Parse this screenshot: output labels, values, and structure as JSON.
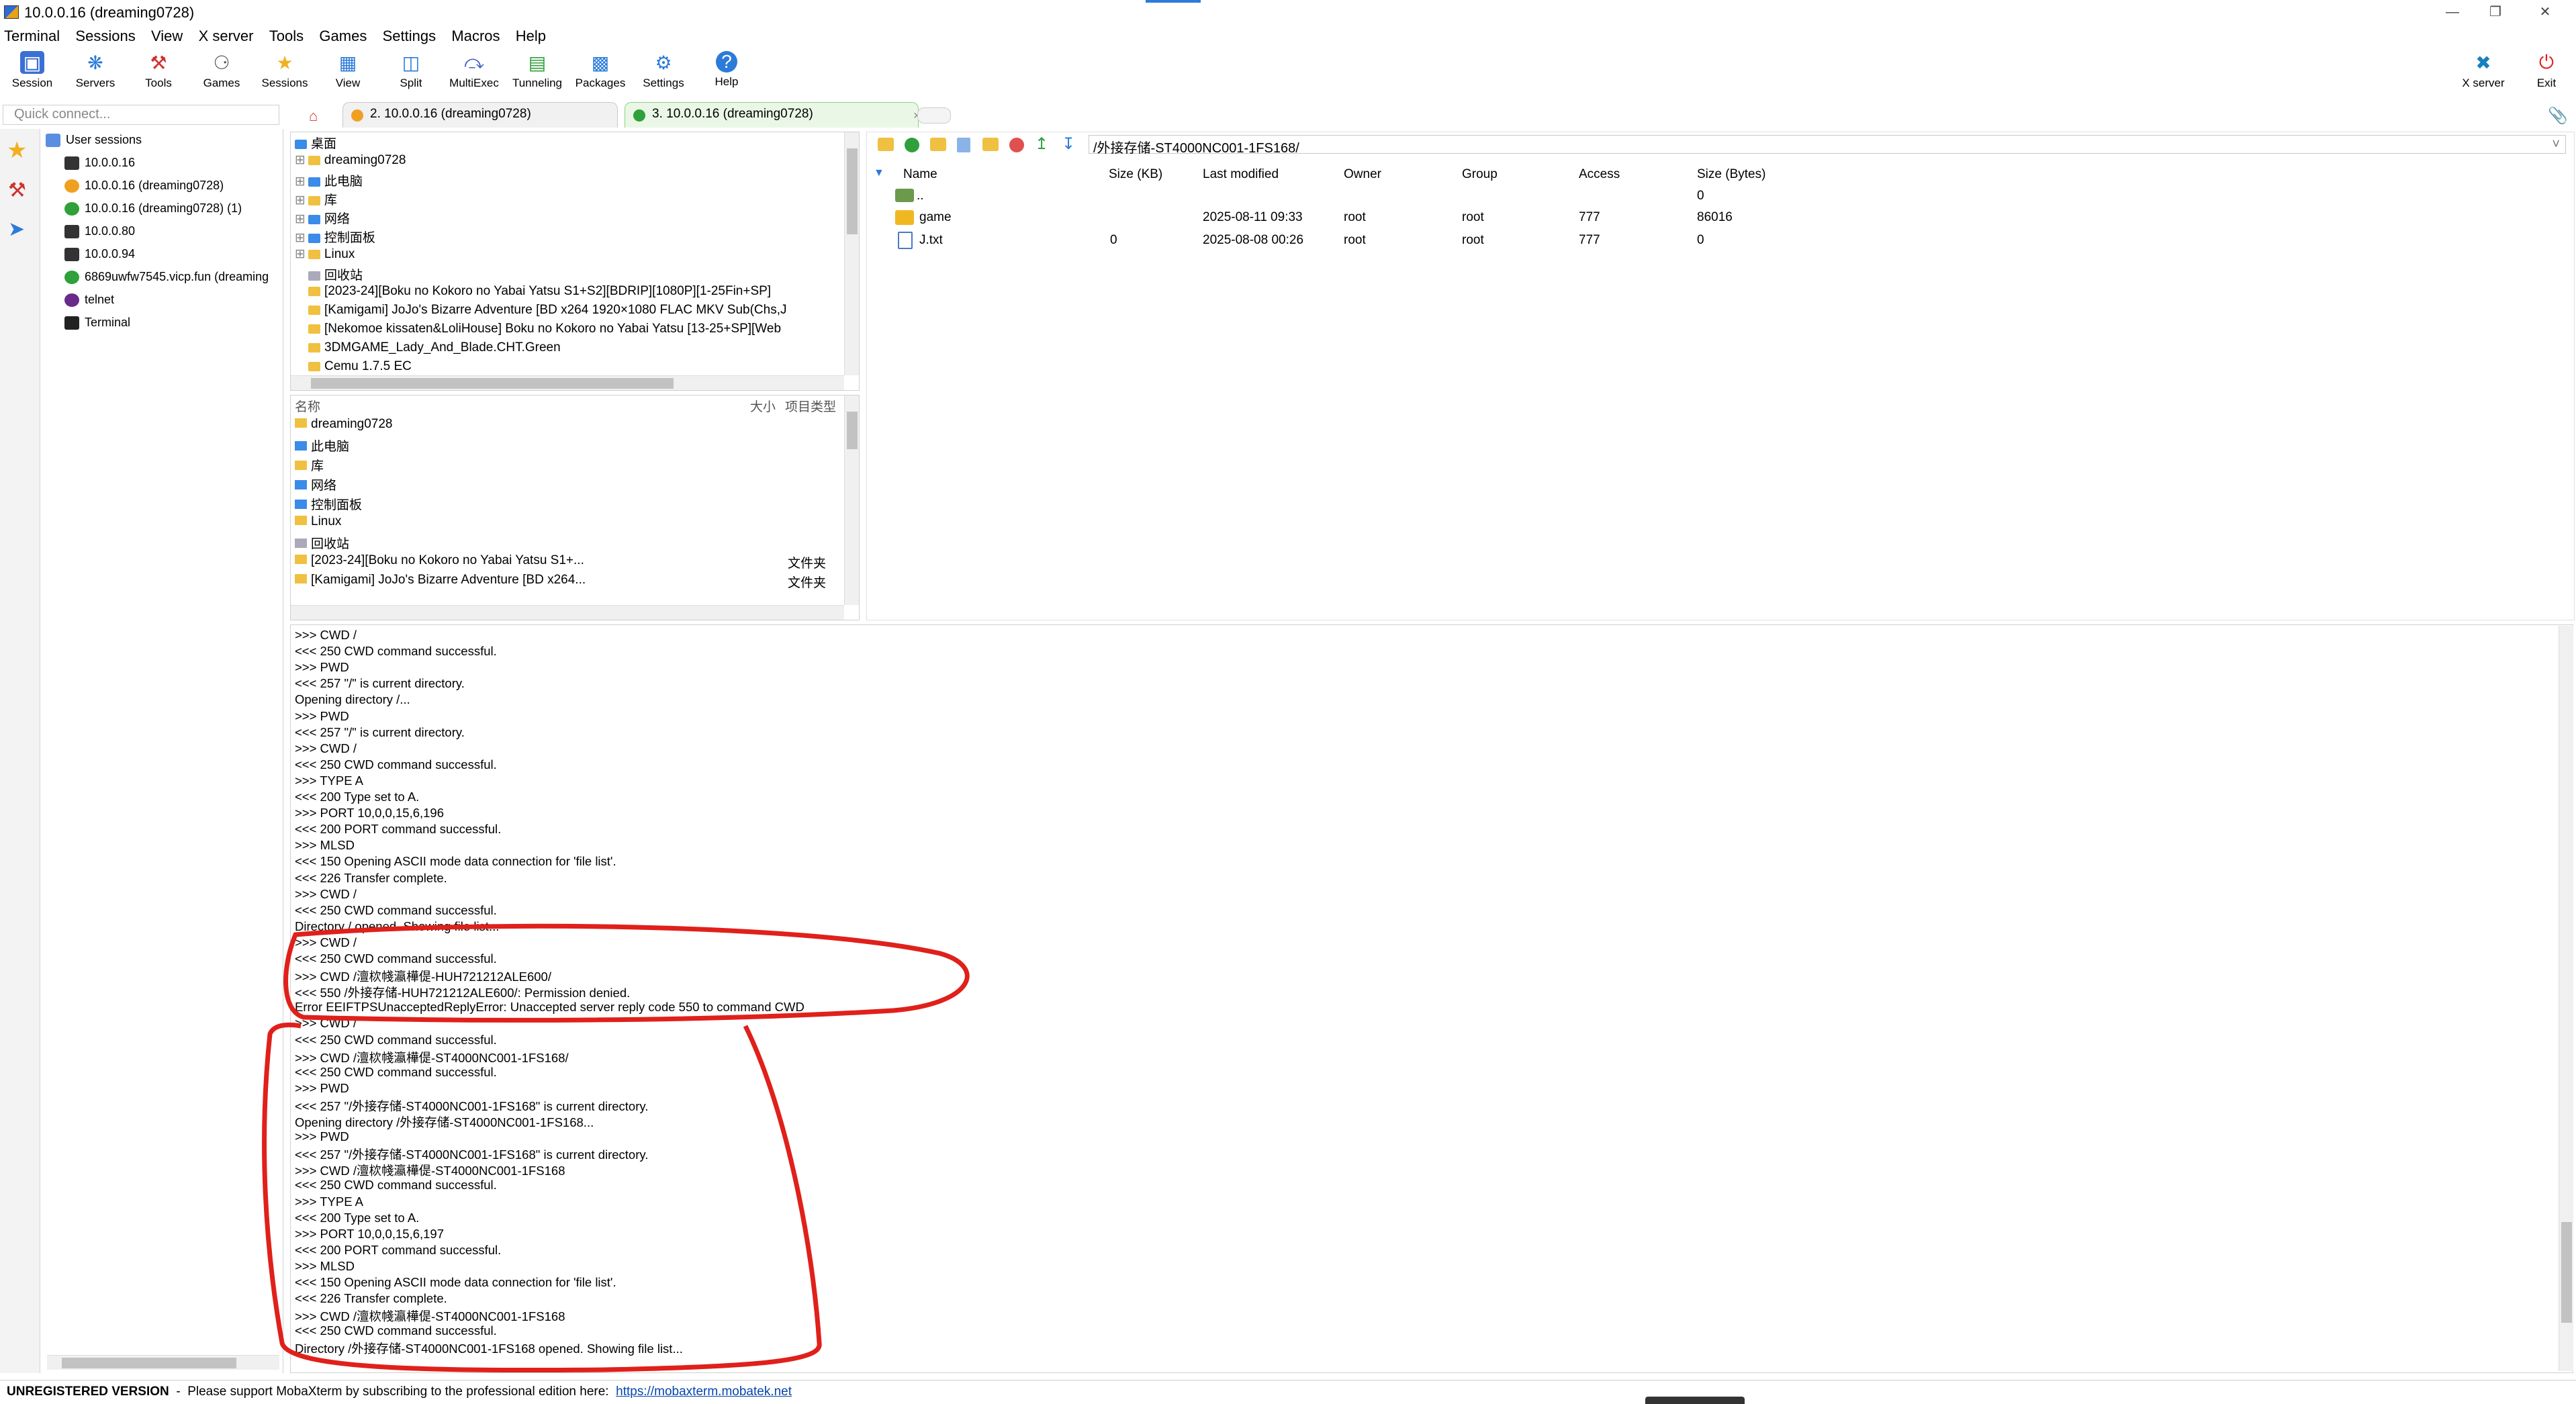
{
  "window": {
    "title": "10.0.0.16 (dreaming0728)"
  },
  "menu": [
    "Terminal",
    "Sessions",
    "View",
    "X server",
    "Tools",
    "Games",
    "Settings",
    "Macros",
    "Help"
  ],
  "toolbar": {
    "items": [
      "Session",
      "Servers",
      "Tools",
      "Games",
      "Sessions",
      "View",
      "Split",
      "MultiExec",
      "Tunneling",
      "Packages",
      "Settings",
      "Help"
    ],
    "right_items": [
      "X server",
      "Exit"
    ]
  },
  "quick_connect": {
    "placeholder": "Quick connect..."
  },
  "tabs": [
    {
      "label": "2. 10.0.0.16 (dreaming0728)",
      "active": false,
      "color": "#f0a020"
    },
    {
      "label": "3. 10.0.0.16 (dreaming0728)",
      "active": true,
      "color": "#2fa03a"
    }
  ],
  "sessions": {
    "header": "User sessions",
    "items": [
      {
        "label": "10.0.0.16",
        "color": "#333333"
      },
      {
        "label": "10.0.0.16 (dreaming0728)",
        "color": "#f0a020"
      },
      {
        "label": "10.0.0.16 (dreaming0728) (1)",
        "color": "#2fa03a"
      },
      {
        "label": "10.0.0.80",
        "color": "#333333"
      },
      {
        "label": "10.0.0.94",
        "color": "#333333"
      },
      {
        "label": "6869uwfw7545.vicp.fun (dreaming",
        "color": "#2fa03a"
      },
      {
        "label": "telnet",
        "color": "#6a2a8a"
      },
      {
        "label": "Terminal",
        "color": "#222222"
      }
    ]
  },
  "local_tree": {
    "items": [
      "桌面",
      "dreaming0728",
      "此电脑",
      "库",
      "网络",
      "控制面板",
      "Linux",
      "回收站",
      "[2023-24][Boku no Kokoro no Yabai Yatsu S1+S2][BDRIP][1080P][1-25Fin+SP]",
      "[Kamigami] JoJo's Bizarre Adventure [BD x264 1920×1080 FLAC MKV Sub(Chs,J",
      "[Nekomoe kissaten&LoliHouse] Boku no Kokoro no Yabai Yatsu [13-25+SP][Web",
      "3DMGAME_Lady_And_Blade.CHT.Green",
      "Cemu 1.7.5 EC"
    ]
  },
  "local_list": {
    "headers": {
      "name": "名称",
      "size": "大小",
      "type": "项目类型"
    },
    "rows": [
      {
        "name": "dreaming0728",
        "type": ""
      },
      {
        "name": "此电脑",
        "type": ""
      },
      {
        "name": "库",
        "type": ""
      },
      {
        "name": "网络",
        "type": ""
      },
      {
        "name": "控制面板",
        "type": ""
      },
      {
        "name": "Linux",
        "type": ""
      },
      {
        "name": "回收站",
        "type": ""
      },
      {
        "name": "[2023-24][Boku no Kokoro no Yabai Yatsu S1+...",
        "type": "文件夹"
      },
      {
        "name": "[Kamigami] JoJo's Bizarre Adventure [BD x264...",
        "type": "文件夹"
      }
    ]
  },
  "remote": {
    "path": "/外接存储-ST4000NC001-1FS168/",
    "headers": [
      "Name",
      "Size (KB)",
      "Last modified",
      "Owner",
      "Group",
      "Access",
      "Size (Bytes)"
    ],
    "rows": [
      {
        "name": "..",
        "size": "",
        "modified": "",
        "owner": "",
        "group": "",
        "access": "",
        "bytes": "0",
        "icon": "up-icon"
      },
      {
        "name": "game",
        "size": "",
        "modified": "2025-08-11 09:33",
        "owner": "root",
        "group": "root",
        "access": "777",
        "bytes": "86016",
        "icon": "folder-icon"
      },
      {
        "name": "J.txt",
        "size": "0",
        "modified": "2025-08-08 00:26",
        "owner": "root",
        "group": "root",
        "access": "777",
        "bytes": "0",
        "icon": "file-icon"
      }
    ]
  },
  "log": [
    ">>>  CWD /",
    "<<<  250 CWD command successful.",
    ">>>  PWD",
    "<<<  257 \"/\" is current directory.",
    "Opening directory /...",
    ">>>  PWD",
    "<<<  257 \"/\" is current directory.",
    ">>>  CWD /",
    "<<<  250 CWD command successful.",
    ">>>  TYPE A",
    "<<<  200 Type set to A.",
    ">>>  PORT 10,0,0,15,6,196",
    "<<<  200 PORT command successful.",
    ">>>  MLSD",
    "<<<  150 Opening ASCII mode data connection for 'file list'.",
    "<<<  226 Transfer complete.",
    ">>>  CWD /",
    "<<<  250 CWD command successful.",
    "Directory / opened. Showing file list...",
    ">>>  CWD /",
    "<<<  250 CWD command successful.",
    ">>>  CWD /澶栨帴瀛樺偍-HUH721212ALE600/",
    "<<<  550 /外接存储-HUH721212ALE600/: Permission denied.",
    "Error EEIFTPSUnacceptedReplyError: Unaccepted server reply code 550 to command CWD",
    ">>>  CWD /",
    "<<<  250 CWD command successful.",
    ">>>  CWD /澶栨帴瀛樺偍-ST4000NC001-1FS168/",
    "<<<  250 CWD command successful.",
    ">>>  PWD",
    "<<<  257 \"/外接存储-ST4000NC001-1FS168\" is current directory.",
    "Opening directory /外接存储-ST4000NC001-1FS168...",
    ">>>  PWD",
    "<<<  257 \"/外接存储-ST4000NC001-1FS168\" is current directory.",
    ">>>  CWD /澶栨帴瀛樺偍-ST4000NC001-1FS168",
    "<<<  250 CWD command successful.",
    ">>>  TYPE A",
    "<<<  200 Type set to A.",
    ">>>  PORT 10,0,0,15,6,197",
    "<<<  200 PORT command successful.",
    ">>>  MLSD",
    "<<<  150 Opening ASCII mode data connection for 'file list'.",
    "<<<  226 Transfer complete.",
    ">>>  CWD /澶栨帴瀛樺偍-ST4000NC001-1FS168",
    "<<<  250 CWD command successful.",
    "Directory /外接存储-ST4000NC001-1FS168 opened. Showing file list..."
  ],
  "status": {
    "version": "UNREGISTERED VERSION",
    "message": "  -  Please support MobaXterm by subscribing to the professional edition here:  ",
    "link": "https://mobaxterm.mobatek.net"
  },
  "colors": {
    "annotation": "#e0201a",
    "accent": "#2b7bd9",
    "link": "#0645ad"
  }
}
